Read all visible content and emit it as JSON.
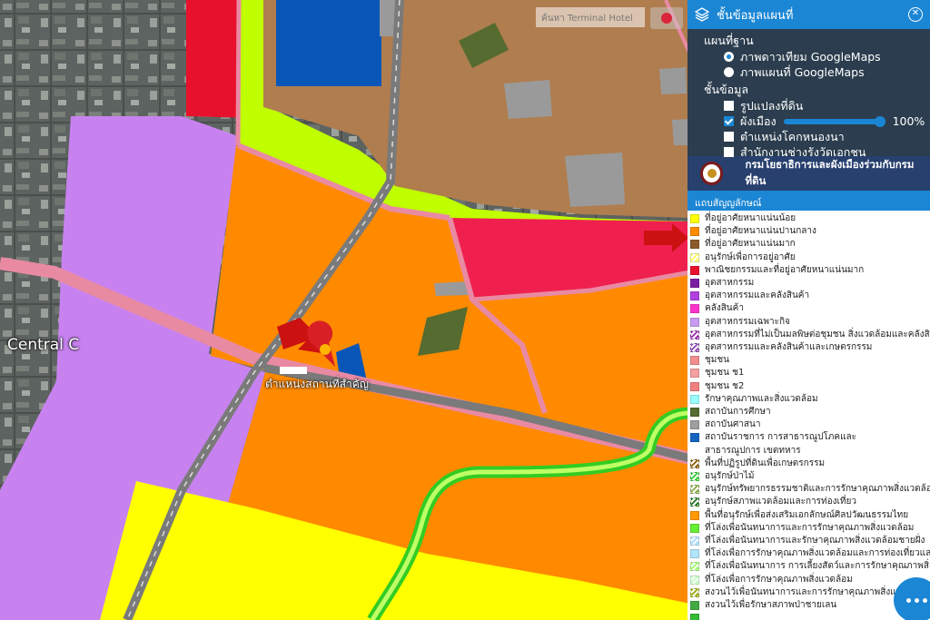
{
  "map": {
    "place_label": "Central C",
    "marker_label": "ตำแหน่งสถานที่สำคัญ",
    "search_placeholder": "ค้นหา Terminal Hotel"
  },
  "panel": {
    "title": "ชั้นข้อมูลแผนที่",
    "basemap_heading": "แผนที่ฐาน",
    "basemaps": [
      {
        "label": "ภาพดาวเทียม GoogleMaps",
        "selected": true
      },
      {
        "label": "ภาพแผนที่ GoogleMaps",
        "selected": false
      }
    ],
    "layers_heading": "ชั้นข้อมูล",
    "layers": [
      {
        "label": "รูปแปลงที่ดิน",
        "checked": false
      },
      {
        "label": "ผังเมือง",
        "checked": true,
        "opacity": "100%"
      },
      {
        "label": "ตำแหน่งโคกหนองนา",
        "checked": false
      },
      {
        "label": "สำนักงานช่างรังวัดเอกชน",
        "checked": false
      }
    ],
    "banner": "กรมโยธาธิการและผังเมืองร่วมกับกรมที่ดิน",
    "legend_heading": "แถบสัญญลักษณ์",
    "legend": [
      {
        "label": "ที่อยู่อาศัยหนาแน่นน้อย",
        "color": "#ffff00"
      },
      {
        "label": "ที่อยู่อาศัยหนาแน่นปานกลาง",
        "color": "#ff8c00"
      },
      {
        "label": "ที่อยู่อาศัยหนาแน่นมาก",
        "color": "#8b5a2b"
      },
      {
        "label": "อนุรักษ์เพื่อการอยู่อาศัย",
        "color": "#ffff66",
        "hatch": true
      },
      {
        "label": "พาณิชยกรรมและที่อยู่อาศัยหนาแน่นมาก",
        "color": "#e8112d"
      },
      {
        "label": "อุตสาหกรรม",
        "color": "#7b1fa2"
      },
      {
        "label": "อุตสาหกรรมและคลังสินค้า",
        "color": "#b040e0"
      },
      {
        "label": "คลังสินค้า",
        "color": "#ff33cc"
      },
      {
        "label": "อุตสาหกรรมเฉพาะกิจ",
        "color": "#c79cf0"
      },
      {
        "label": "อุตสาหกรรมที่ไม่เป็นมลพิษต่อชุมชน สิ่งแวดล้อมและคลังสินค้า",
        "color": "#9c27b0",
        "hatch": true
      },
      {
        "label": "อุตสาหกรรมและคลังสินค้าและเกษตรกรรม",
        "color": "#8e44ad",
        "hatch": true
      },
      {
        "label": "ชุมชน",
        "color": "#f28e8e"
      },
      {
        "label": "ชุมชน ช1",
        "color": "#f4a0a0"
      },
      {
        "label": "ชุมชน ช2",
        "color": "#f08080"
      },
      {
        "label": "รักษาคุณภาพและสิ่งแวดล้อม",
        "color": "#99ffff"
      },
      {
        "label": "สถาบันการศึกษา",
        "color": "#556b2f"
      },
      {
        "label": "สถาบันศาสนา",
        "color": "#9e9e9e"
      },
      {
        "label": "สถาบันราชการ การสาธารณูปโภคและสาธารณูปการ เขตทหาร",
        "color": "#1565c0",
        "wrap": true
      },
      {
        "label": "พื้นที่ปฏิรูปที่ดินเพื่อเกษตรกรรม",
        "color": "#8b5a00",
        "hatch": true
      },
      {
        "label": "อนุรักษ์ป่าไม้",
        "color": "#33cc33",
        "hatch": true
      },
      {
        "label": "อนุรักษ์ทรัพยากรธรรมชาติและการรักษาคุณภาพสิ่งแวดล้อม",
        "color": "#88aa44",
        "hatch": true
      },
      {
        "label": "อนุรักษ์สภาพแวดล้อมและการท่องเที่ยว",
        "color": "#227722",
        "hatch": true
      },
      {
        "label": "พื้นที่อนุรักษ์เพื่อส่งเสริมเอกลักษณ์ศิลปวัฒนธรรมไทย",
        "color": "#ff9900"
      },
      {
        "label": "ที่โล่งเพื่อนันทนาการและการรักษาคุณภาพสิ่งแวดล้อม",
        "color": "#66ee33"
      },
      {
        "label": "ที่โล่งเพื่อนันทนาการและรักษาคุณภาพสิ่งแวดล้อมชายฝั่ง",
        "color": "#a0d8ff",
        "hatch": true
      },
      {
        "label": "ที่โล่งเพื่อการรักษาคุณภาพสิ่งแวดล้อมและการท่องเที่ยวและการป",
        "color": "#b3e5fc"
      },
      {
        "label": "ที่โล่งเพื่อนันทนาการ การเลี้ยงสัตว์และการรักษาคุณภาพสิ่งแ",
        "color": "#99ff66",
        "hatch": true
      },
      {
        "label": "ที่โล่งเพื่อการรักษาคุณภาพสิ่งแวดล้อม",
        "color": "#bbffbb",
        "hatch": true
      },
      {
        "label": "สงวนไว้เพื่อนันทนาการและการรักษาคุณภาพสิ่งแวดล้อม",
        "color": "#99aa00",
        "hatch": true
      },
      {
        "label": "สงวนไว้เพื่อรักษาสภาพป่าชายเลน",
        "color": "#44aa44"
      },
      {
        "label": "",
        "color": "#33bb33"
      }
    ]
  },
  "colors": {
    "accent": "#1b86d4",
    "panel_bg": "#2b3d4e",
    "banner_bg": "#27406e"
  }
}
